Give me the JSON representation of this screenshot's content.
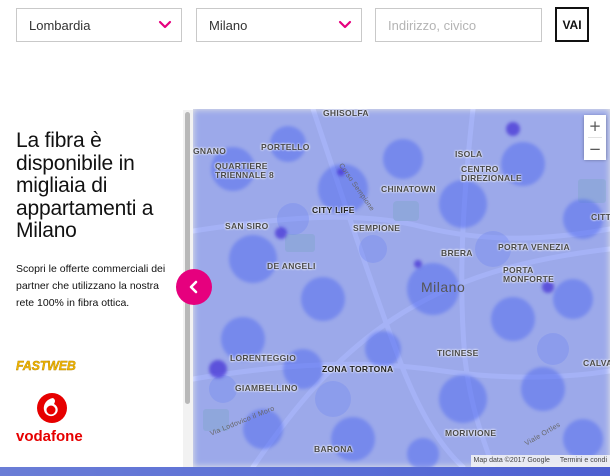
{
  "search": {
    "region_value": "Lombardia",
    "city_value": "Milano",
    "address_placeholder": "Indirizzo, civico",
    "submit_label": "VAI",
    "chevron_icon": "chevron-down-icon",
    "chevron_color": "#e6007e"
  },
  "info": {
    "headline": "La fibra è disponibile in migliaia di appartamenti a Milano",
    "description": "Scopri le offerte commerciali dei partner che utilizzano la nostra rete 100% in fibra ottica.",
    "partners": [
      {
        "name": "FASTWEB",
        "logo": "fastweb-logo"
      },
      {
        "name": "vodafone",
        "logo": "vodafone-logo"
      }
    ]
  },
  "carousel": {
    "prev_icon": "chevron-left-icon",
    "accent": "#e6007e"
  },
  "map": {
    "city_label": "Milano",
    "districts": [
      "GHISOLFA",
      "GNANO",
      "PORTELLO",
      "QUARTIERE TRIENNALE 8",
      "ISOLA",
      "CENTRO DIREZIONALE",
      "CHINATOWN",
      "CITY LIFE",
      "SAN SIRO",
      "SEMPIONE",
      "BRERA",
      "PORTA VENEZIA",
      "DE ANGELI",
      "PORTA MONFORTE",
      "CITT",
      "LORENTEGGIO",
      "ZONA TORTONA",
      "TICINESE",
      "CALVA",
      "GIAMBELLINO",
      "MORIVIONE",
      "BARONA"
    ],
    "streets": [
      "Corso Sempione",
      "Via Lodovico il Moro",
      "Viale Ortles"
    ],
    "zoom_in": "+",
    "zoom_out": "−",
    "attribution": "Map data ©2017 Google",
    "terms": "Termini e condi",
    "heat_color": "#4a64f0"
  }
}
